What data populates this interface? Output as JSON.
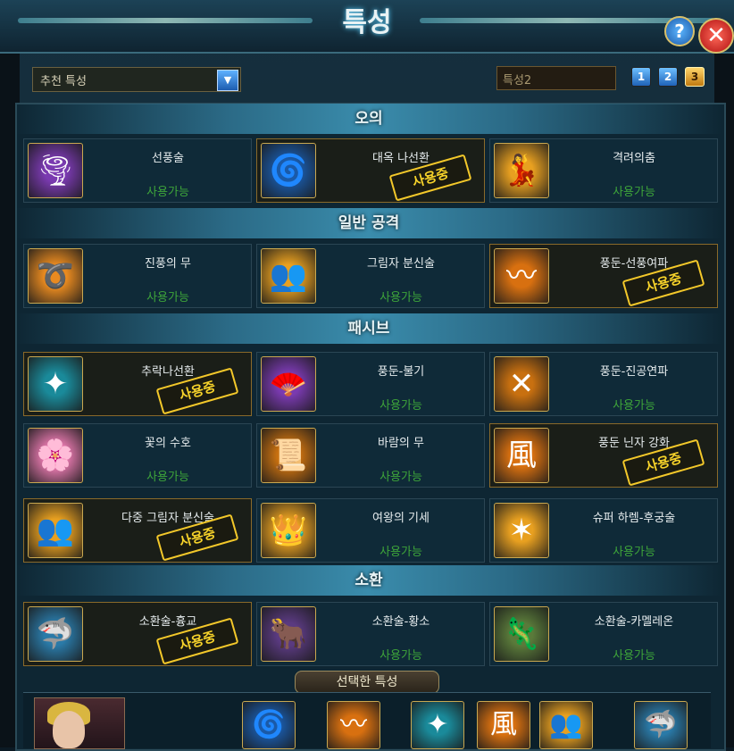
{
  "window": {
    "title": "특성",
    "help_label": "?",
    "close_label": "✕"
  },
  "toolbar": {
    "dropdown_value": "추천 특성",
    "preset_name": "특성2",
    "preset_buttons": [
      "1",
      "2",
      "3"
    ],
    "active_preset": "3"
  },
  "status_available": "사용가능",
  "stamp_label": "사용중",
  "sections": [
    {
      "title": "오의",
      "cards": [
        {
          "name": "선풍술",
          "status": "사용가능",
          "used": false,
          "icon": "tornado-icon",
          "color": "#7a3ab0"
        },
        {
          "name": "대옥 나선환",
          "status": "",
          "used": true,
          "icon": "spiral-orb-icon",
          "color": "#1a5aa8"
        },
        {
          "name": "격려의춤",
          "status": "사용가능",
          "used": false,
          "icon": "dancer-icon",
          "color": "#e8a020"
        }
      ]
    },
    {
      "title": "일반 공격",
      "cards": [
        {
          "name": "진풍의 무",
          "status": "사용가능",
          "used": false,
          "icon": "swirl-icon",
          "color": "#e88a20"
        },
        {
          "name": "그림자 분신술",
          "status": "사용가능",
          "used": false,
          "icon": "shadow-clone-icon",
          "color": "#e8a020"
        },
        {
          "name": "풍둔-선풍여파",
          "status": "",
          "used": true,
          "icon": "wind-slash-icon",
          "color": "#d87010"
        }
      ]
    },
    {
      "title": "패시브",
      "cards": [
        {
          "name": "추락나선환",
          "status": "",
          "used": true,
          "icon": "falling-spiral-icon",
          "color": "#1a8a9a"
        },
        {
          "name": "풍둔-불기",
          "status": "사용가능",
          "used": false,
          "icon": "fan-icon",
          "color": "#7a3ab0"
        },
        {
          "name": "풍둔-진공연파",
          "status": "사용가능",
          "used": false,
          "icon": "vacuum-wave-icon",
          "color": "#c87010"
        },
        {
          "name": "꽃의 수호",
          "status": "사용가능",
          "used": false,
          "icon": "flower-girl-icon",
          "color": "#e87ab0"
        },
        {
          "name": "바람의 무",
          "status": "사용가능",
          "used": false,
          "icon": "scroll-icon",
          "color": "#c87010"
        },
        {
          "name": "풍둔 닌자 강화",
          "status": "",
          "used": true,
          "icon": "wind-kanji-icon",
          "color": "#d87010"
        },
        {
          "name": "다중 그림자 분신술",
          "status": "",
          "used": true,
          "icon": "multi-clone-icon",
          "color": "#e8a020"
        },
        {
          "name": "여왕의 기세",
          "status": "사용가능",
          "used": false,
          "icon": "queen-icon",
          "color": "#e8a020"
        },
        {
          "name": "슈퍼 하렘-후궁술",
          "status": "사용가능",
          "used": false,
          "icon": "harem-icon",
          "color": "#e8a020"
        }
      ]
    },
    {
      "title": "소환",
      "cards": [
        {
          "name": "소환술-흉교",
          "status": "",
          "used": true,
          "icon": "shark-icon",
          "color": "#2a7aa8"
        },
        {
          "name": "소환술-황소",
          "status": "사용가능",
          "used": false,
          "icon": "ox-icon",
          "color": "#5a3a80"
        },
        {
          "name": "소환술-카멜레온",
          "status": "사용가능",
          "used": false,
          "icon": "chameleon-icon",
          "color": "#5a7a3a"
        }
      ]
    }
  ],
  "selected": {
    "label": "선택한 특성",
    "icons": [
      {
        "icon": "spiral-orb-icon",
        "color": "#1a5aa8"
      },
      {
        "icon": "wind-slash-icon",
        "color": "#d87010"
      },
      {
        "icon": "falling-spiral-icon",
        "color": "#1a8a9a"
      },
      {
        "icon": "wind-kanji-icon",
        "color": "#d87010"
      },
      {
        "icon": "multi-clone-icon",
        "color": "#e8a020"
      },
      {
        "icon": "shark-icon",
        "color": "#2a7aa8"
      }
    ]
  }
}
